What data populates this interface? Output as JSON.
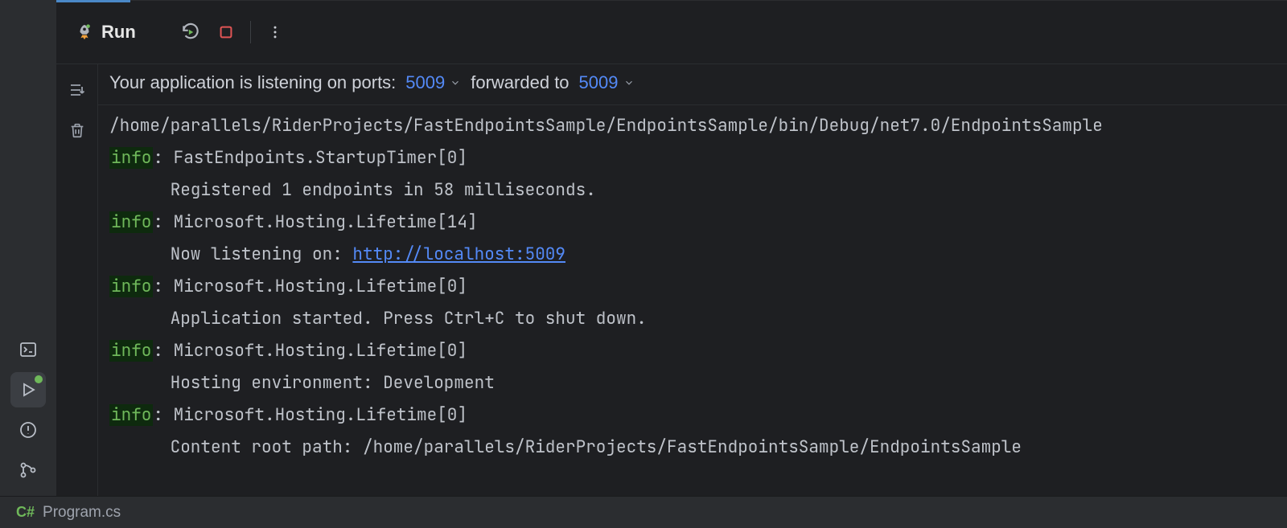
{
  "header": {
    "run_label": "Run"
  },
  "ports": {
    "label": "Your application is listening on ports:",
    "local_port": "5009",
    "forwarded_label": "forwarded to",
    "forwarded_port": "5009"
  },
  "console": {
    "exe_path": "/home/parallels/RiderProjects/FastEndpointsSample/EndpointsSample/bin/Debug/net7.0/EndpointsSample",
    "info_tag": "info",
    "lines": [
      {
        "source": "FastEndpoints.StartupTimer[0]",
        "message": "Registered 1 endpoints in 58 milliseconds."
      },
      {
        "source": "Microsoft.Hosting.Lifetime[14]",
        "message_prefix": "Now listening on: ",
        "link": "http://localhost:5009"
      },
      {
        "source": "Microsoft.Hosting.Lifetime[0]",
        "message": "Application started. Press Ctrl+C to shut down."
      },
      {
        "source": "Microsoft.Hosting.Lifetime[0]",
        "message": "Hosting environment: Development"
      },
      {
        "source": "Microsoft.Hosting.Lifetime[0]",
        "message": "Content root path: /home/parallels/RiderProjects/FastEndpointsSample/EndpointsSample"
      }
    ]
  },
  "status": {
    "lang_badge": "C#",
    "file": "Program.cs"
  }
}
